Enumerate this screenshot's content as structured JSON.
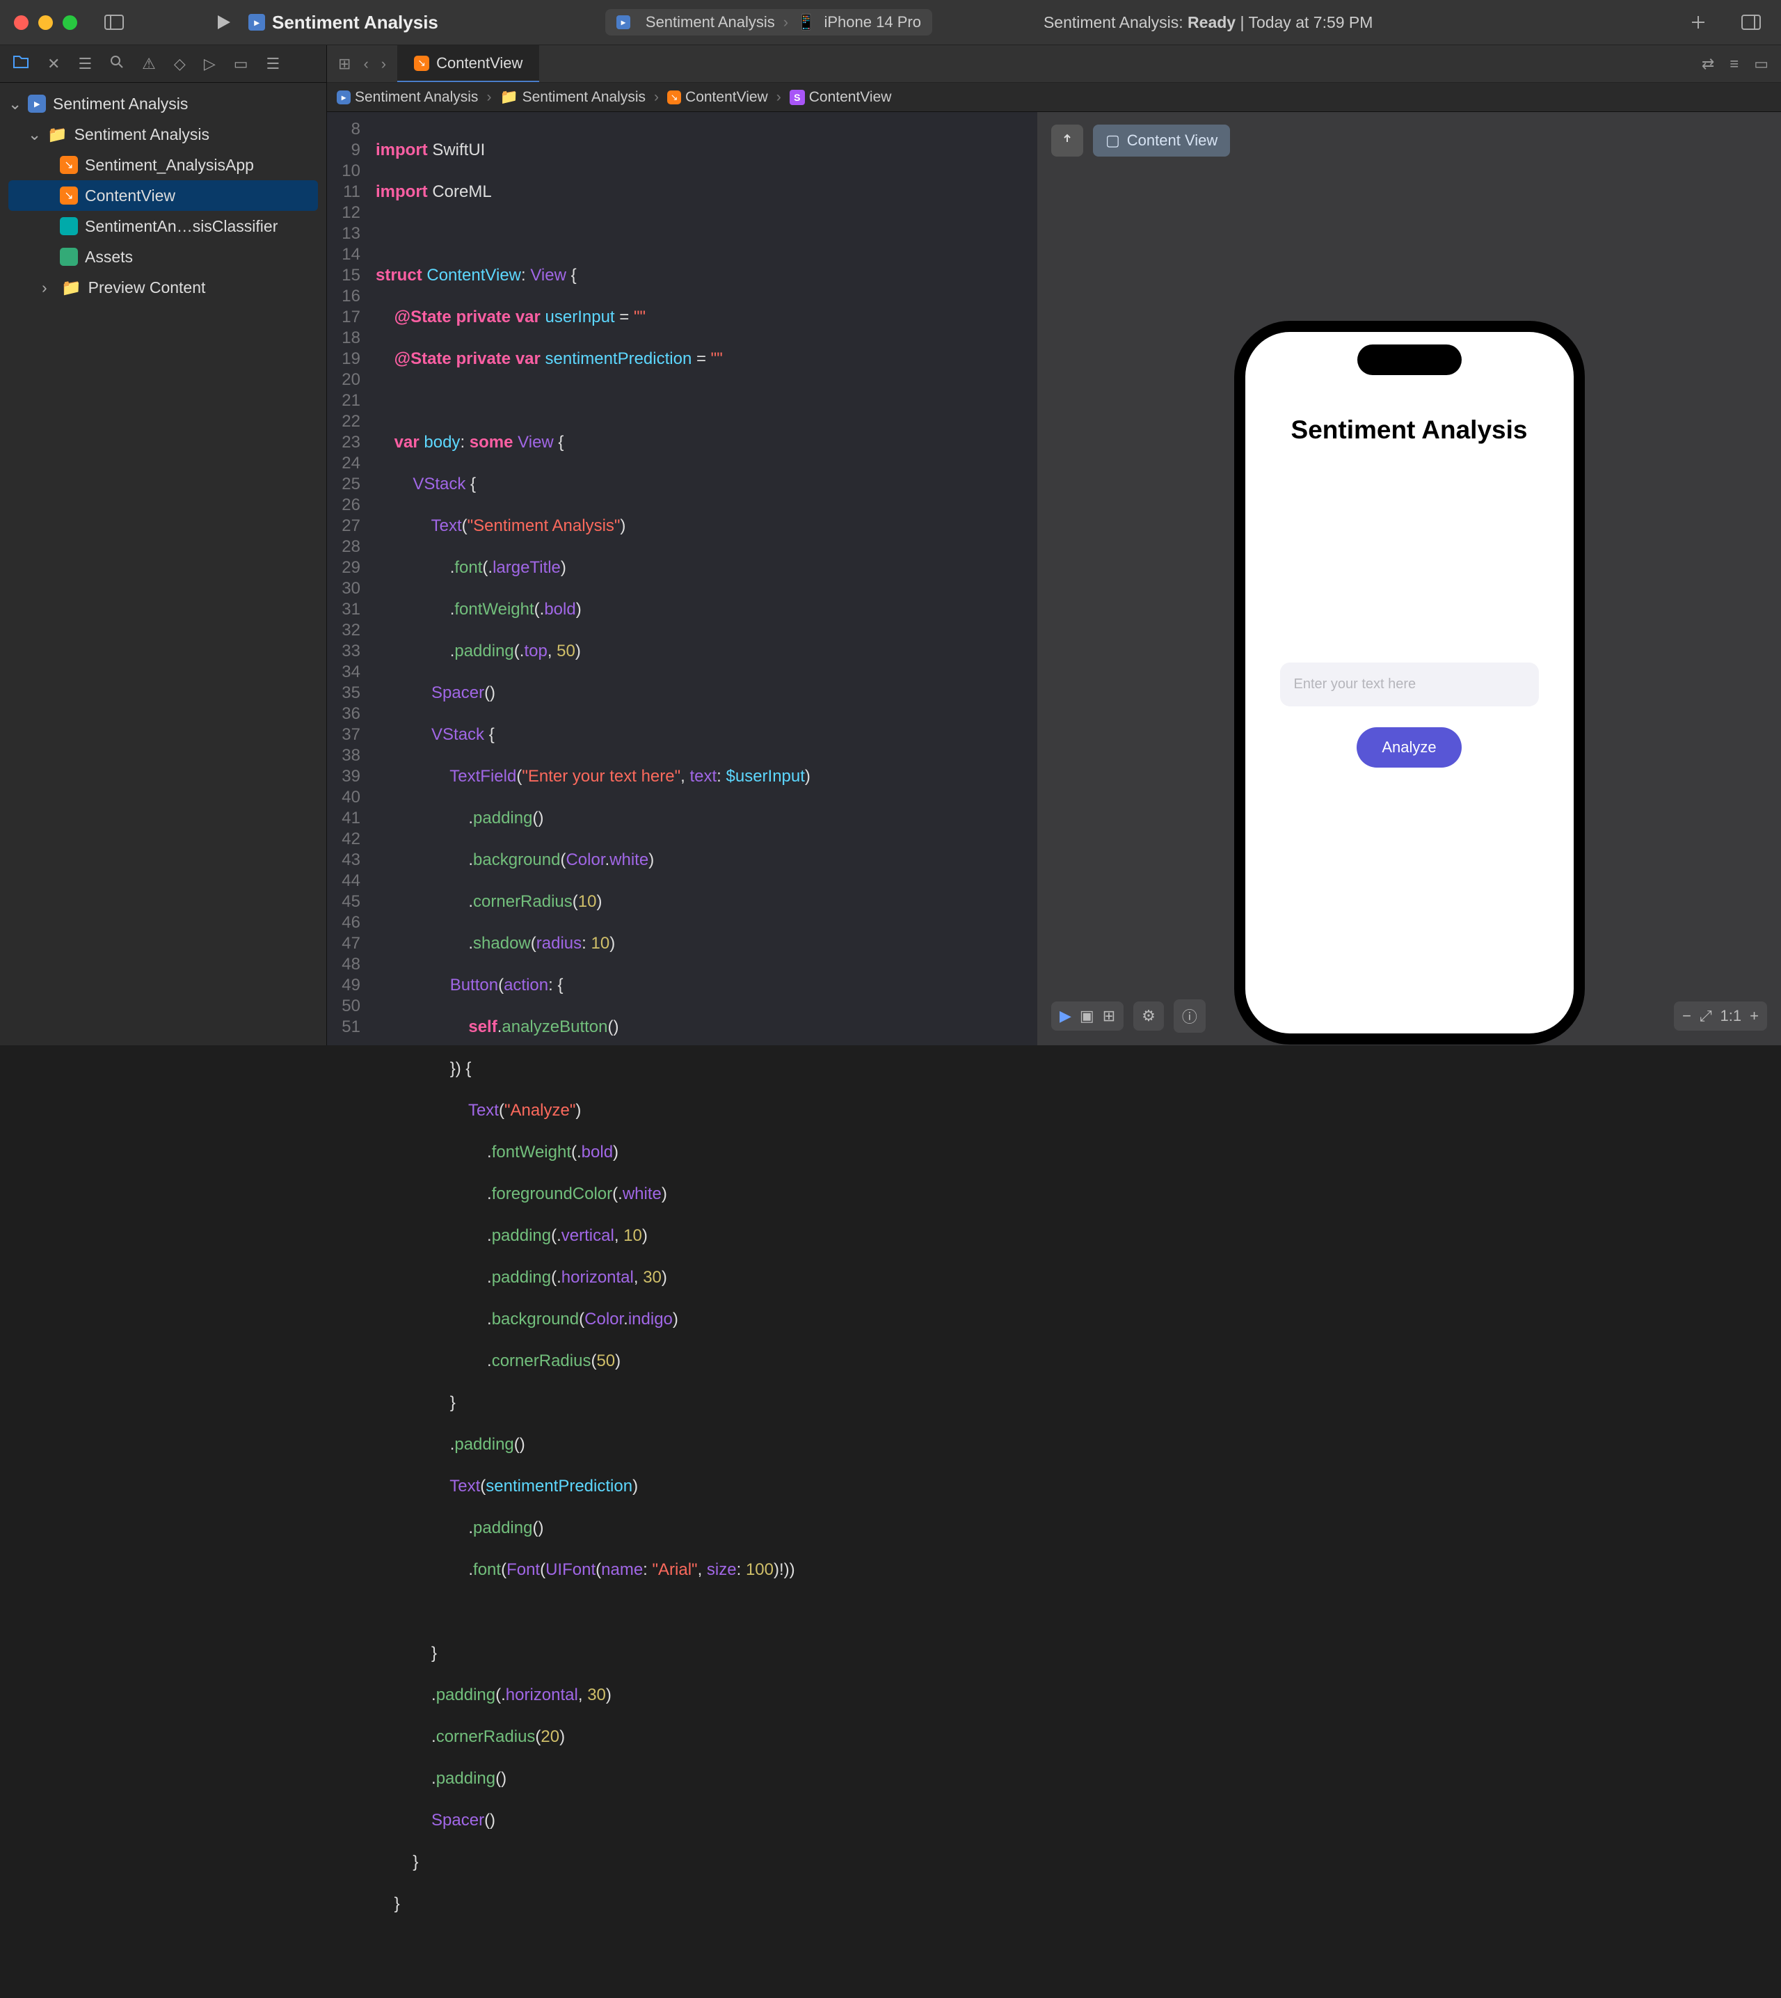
{
  "titlebar": {
    "project_name": "Sentiment Analysis",
    "scheme": "Sentiment Analysis",
    "device": "iPhone 14 Pro",
    "status_prefix": "Sentiment Analysis:",
    "status_state": "Ready",
    "status_time": "Today at 7:59 PM"
  },
  "navigator": {
    "root": "Sentiment Analysis",
    "group": "Sentiment Analysis",
    "items": {
      "app_file": "Sentiment_AnalysisApp",
      "content_view": "ContentView",
      "classifier": "SentimentAn…sisClassifier",
      "assets": "Assets",
      "preview_content": "Preview Content"
    }
  },
  "tab": {
    "active": "ContentView"
  },
  "jumpbar": {
    "seg0": "Sentiment Analysis",
    "seg1": "Sentiment Analysis",
    "seg2": "ContentView",
    "seg3": "ContentView"
  },
  "code": {
    "line_start": 8,
    "line_end": 51,
    "lines": [
      "import SwiftUI",
      "import CoreML",
      "",
      "struct ContentView: View {",
      "    @State private var userInput = \"\"",
      "    @State private var sentimentPrediction = \"\"",
      "",
      "    var body: some View {",
      "        VStack {",
      "            Text(\"Sentiment Analysis\")",
      "                .font(.largeTitle)",
      "                .fontWeight(.bold)",
      "                .padding(.top, 50)",
      "            Spacer()",
      "            VStack {",
      "                TextField(\"Enter your text here\", text: $userInput)",
      "                    .padding()",
      "                    .background(Color.white)",
      "                    .cornerRadius(10)",
      "                    .shadow(radius: 10)",
      "                Button(action: {",
      "                    self.analyzeButton()",
      "                }) {",
      "                    Text(\"Analyze\")",
      "                        .fontWeight(.bold)",
      "                        .foregroundColor(.white)",
      "                        .padding(.vertical, 10)",
      "                        .padding(.horizontal, 30)",
      "                        .background(Color.indigo)",
      "                        .cornerRadius(50)",
      "                }",
      "                .padding()",
      "                Text(sentimentPrediction)",
      "                    .padding()",
      "                    .font(Font(UIFont(name: \"Arial\", size: 100)!))",
      "",
      "            }",
      "            .padding(.horizontal, 30)",
      "            .cornerRadius(20)",
      "            .padding()",
      "            Spacer()",
      "        }",
      "    }",
      ""
    ]
  },
  "canvas": {
    "preview_chip": "Content View",
    "phone_title": "Sentiment Analysis",
    "textfield_placeholder": "Enter your text here",
    "button_label": "Analyze"
  }
}
